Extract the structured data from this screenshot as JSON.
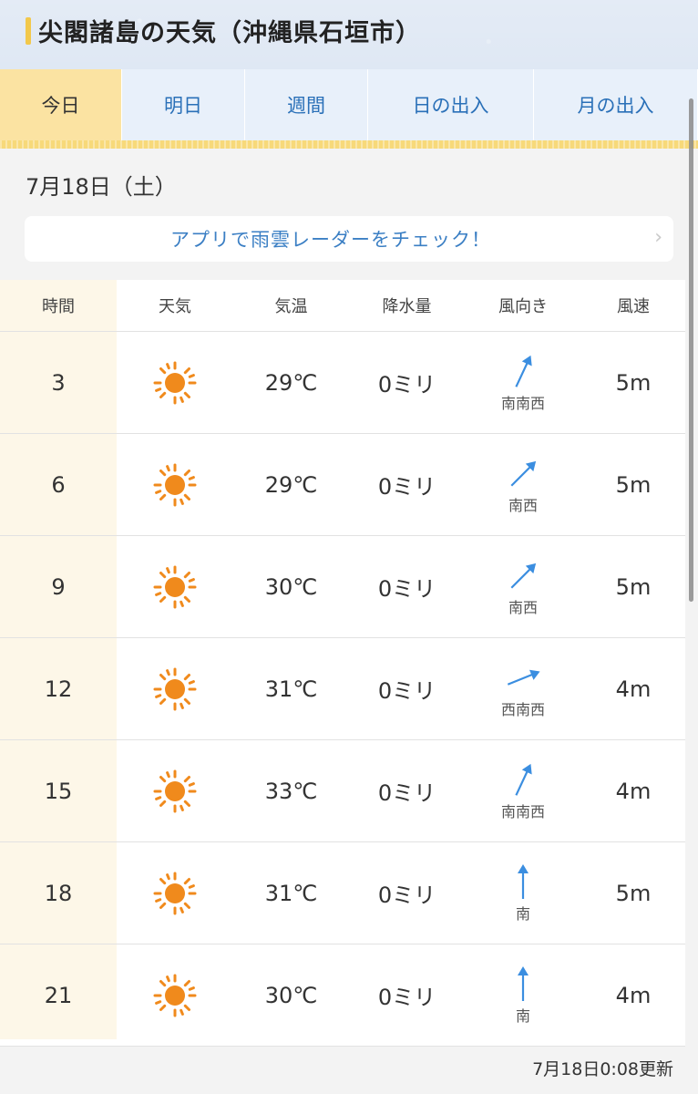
{
  "header": {
    "title": "尖閣諸島の天気（沖縄県石垣市）"
  },
  "tabs": [
    {
      "label": "今日",
      "active": true
    },
    {
      "label": "明日",
      "active": false
    },
    {
      "label": "週間",
      "active": false
    },
    {
      "label": "日の出入",
      "active": false
    },
    {
      "label": "月の出入",
      "active": false
    }
  ],
  "date": "7月18日（土）",
  "app_banner": {
    "label": "アプリで雨雲レーダーをチェック！"
  },
  "table": {
    "headers": [
      "時間",
      "天気",
      "気温",
      "降水量",
      "風向き",
      "風速"
    ],
    "rows": [
      {
        "time": "3",
        "weather": "sunny-icon",
        "temp": "29℃",
        "rain": "0ミリ",
        "wind_dir": "南南西",
        "wind_speed": "5m"
      },
      {
        "time": "6",
        "weather": "sunny-icon",
        "temp": "29℃",
        "rain": "0ミリ",
        "wind_dir": "南西",
        "wind_speed": "5m"
      },
      {
        "time": "9",
        "weather": "sunny-icon",
        "temp": "30℃",
        "rain": "0ミリ",
        "wind_dir": "南西",
        "wind_speed": "5m"
      },
      {
        "time": "12",
        "weather": "sunny-icon",
        "temp": "31℃",
        "rain": "0ミリ",
        "wind_dir": "西南西",
        "wind_speed": "4m"
      },
      {
        "time": "15",
        "weather": "sunny-icon",
        "temp": "33℃",
        "rain": "0ミリ",
        "wind_dir": "南南西",
        "wind_speed": "4m"
      },
      {
        "time": "18",
        "weather": "sunny-icon",
        "temp": "31℃",
        "rain": "0ミリ",
        "wind_dir": "南",
        "wind_speed": "5m"
      },
      {
        "time": "21",
        "weather": "sunny-icon",
        "temp": "30℃",
        "rain": "0ミリ",
        "wind_dir": "南",
        "wind_speed": "4m"
      }
    ]
  },
  "updated": "7月18日0:08更新",
  "colors": {
    "accent": "#2a70b8",
    "tab_active": "#fbe3a2",
    "sun": "#f08a1c",
    "arrow": "#3b8ee0"
  }
}
